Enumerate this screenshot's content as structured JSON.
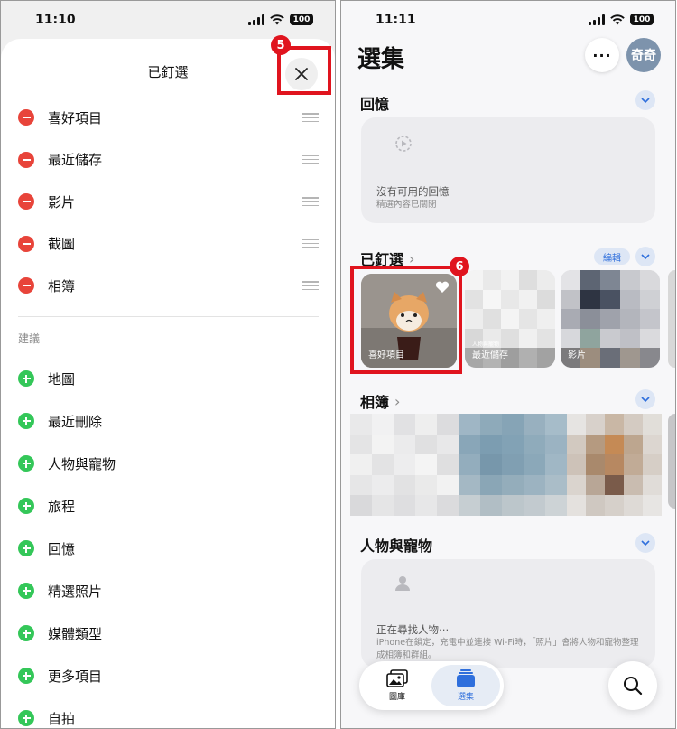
{
  "left": {
    "status": {
      "time": "11:10",
      "battery": "100"
    },
    "sheet_title": "已釘選",
    "pinned": [
      {
        "label": "喜好項目"
      },
      {
        "label": "最近儲存"
      },
      {
        "label": "影片"
      },
      {
        "label": "截圖"
      },
      {
        "label": "相簿"
      }
    ],
    "suggestions_label": "建議",
    "suggestions": [
      {
        "label": "地圖"
      },
      {
        "label": "最近刪除"
      },
      {
        "label": "人物與寵物"
      },
      {
        "label": "旅程"
      },
      {
        "label": "回憶"
      },
      {
        "label": "精選照片"
      },
      {
        "label": "媒體類型"
      },
      {
        "label": "更多項目"
      },
      {
        "label": "自拍"
      }
    ],
    "step_badge": "5"
  },
  "right": {
    "status": {
      "time": "11:11",
      "battery": "100"
    },
    "title": "選集",
    "more_label": "···",
    "avatar_text": "奇奇",
    "memories": {
      "title": "回憶",
      "empty_title": "沒有可用的回憶",
      "empty_sub": "精選內容已關閉"
    },
    "pinned": {
      "title": "已釘選",
      "edit_label": "編輯",
      "tiles": [
        {
          "label": "喜好項目"
        },
        {
          "label": "最近儲存",
          "tag": "人物與寵物"
        },
        {
          "label": "影片"
        }
      ],
      "step_badge": "6"
    },
    "albums": {
      "title": "相簿"
    },
    "people": {
      "title": "人物與寵物",
      "empty_title": "正在尋找人物⋯",
      "empty_sub": "iPhone在鎖定，充電中並連接 Wi-Fi時，「照片」會將人物和寵物整理成相簿和群組。"
    },
    "tabbar": [
      {
        "label": "圖庫"
      },
      {
        "label": "選集"
      }
    ],
    "colors": {
      "accent": "#2f6fdc",
      "highlight": "#e0141e",
      "minus": "#e8443a",
      "plus": "#34c759"
    }
  }
}
